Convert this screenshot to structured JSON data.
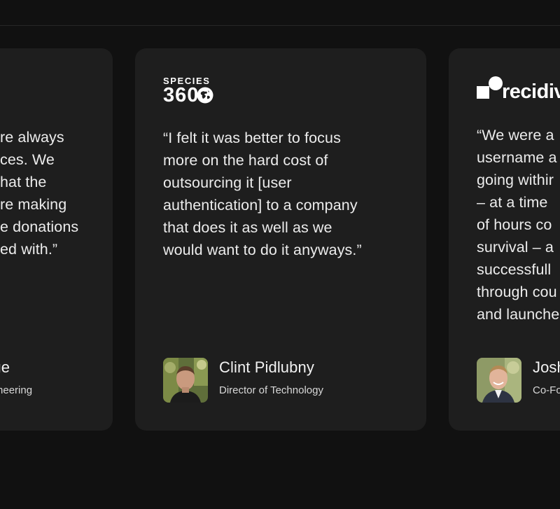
{
  "testimonials": [
    {
      "quote": "re always\nces. We\nhat the\nre making\ne donations\ned with.”",
      "author_name": "rge",
      "author_title": "Engineering"
    },
    {
      "logo": {
        "word": "SPECIES",
        "number": "360",
        "icon": "globe-icon"
      },
      "quote": "“I felt it was better to focus\nmore on the hard cost of\noutsourcing it [user\nauthentication] to a company\nthat does it as well as we\nwould want to do it anyways.”",
      "author_name": "Clint Pidlubny",
      "author_title": "Director of Technology"
    },
    {
      "logo": {
        "word": "recidiv",
        "icon": "recidiviz-mark-icon"
      },
      "quote": "“We were a\nusername a\ngoing withir\n– at a time\nof hours co\nsurvival – a\nsuccessfull\nthrough cou\nand launche",
      "author_name": "Josh",
      "author_title": "Co-Fo"
    }
  ]
}
